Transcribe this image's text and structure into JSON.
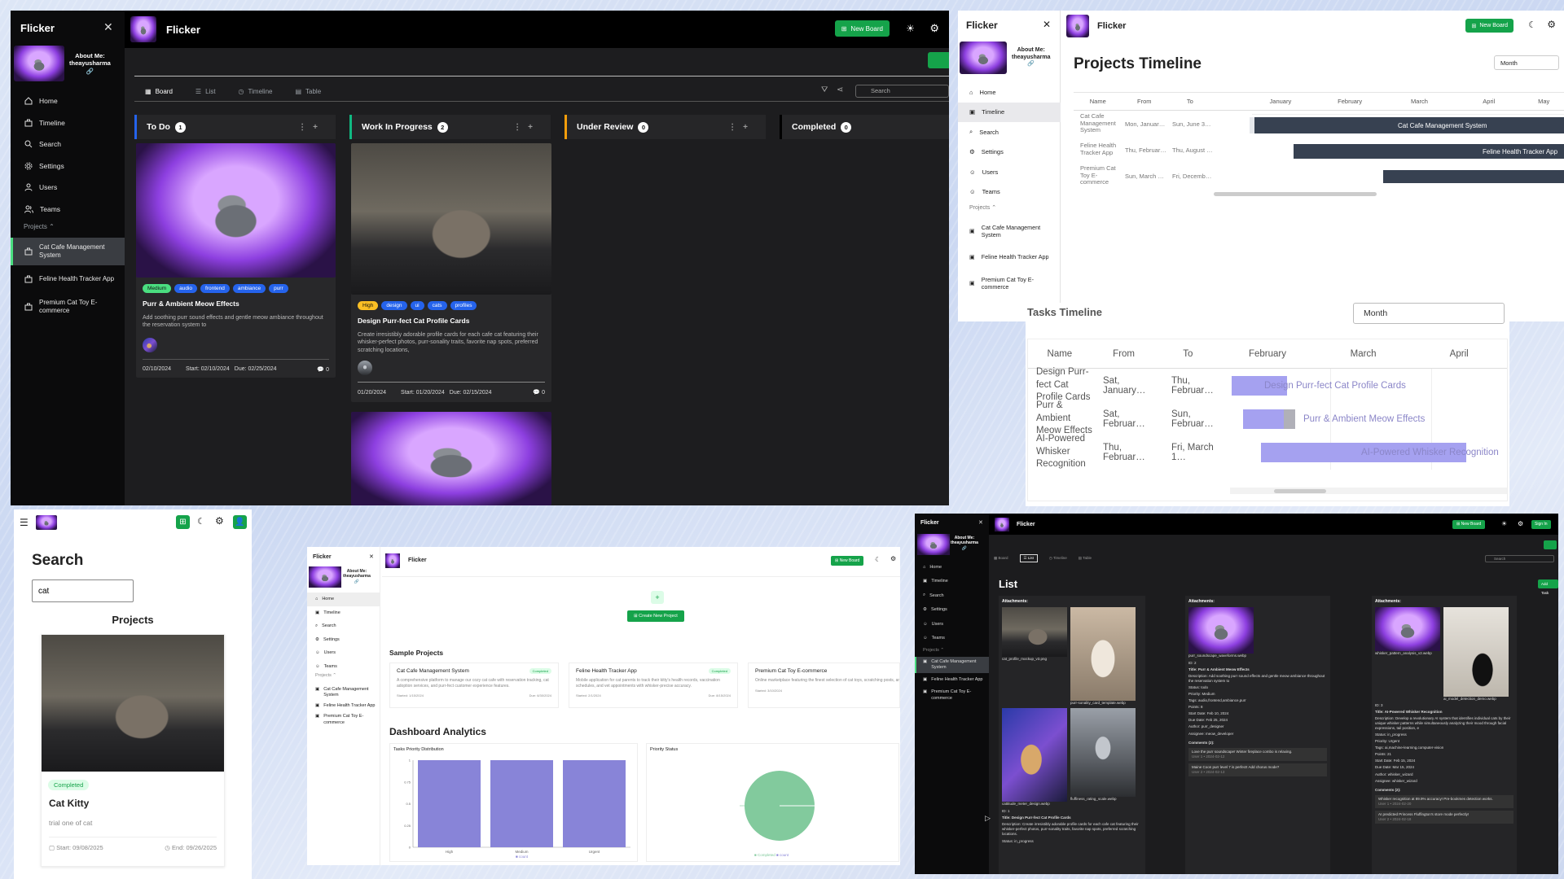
{
  "app": {
    "name": "Flicker",
    "about": "About Me:",
    "username": "theayusharma"
  },
  "nav": [
    "Home",
    "Timeline",
    "Search",
    "Settings",
    "Users",
    "Teams"
  ],
  "projects_header": "Projects",
  "projects": [
    "Cat Cafe Management System",
    "Feline Health Tracker App",
    "Premium Cat Toy E-commerce"
  ],
  "new_board": "New Board",
  "board": {
    "tabs": [
      "Board",
      "List",
      "Timeline",
      "Table"
    ],
    "search_placeholder": "Search",
    "columns": [
      {
        "name": "To Do",
        "count": "1",
        "color": "#2563eb"
      },
      {
        "name": "Work In Progress",
        "count": "2",
        "color": "#10b981"
      },
      {
        "name": "Under Review",
        "count": "0",
        "color": "#f59e0b"
      },
      {
        "name": "Completed",
        "count": "0",
        "color": "#000000"
      }
    ],
    "card1": {
      "tags": [
        "Medium",
        "audio",
        "frontend",
        "ambiance",
        "purr"
      ],
      "title": "Purr & Ambient Meow Effects",
      "desc": "Add soothing purr sound effects and gentle meow ambiance throughout the reservation system to",
      "date": "02/10/2024",
      "start": "Start: 02/10/2024",
      "due": "Due: 02/25/2024",
      "comments": "0"
    },
    "card2": {
      "tags": [
        "High",
        "design",
        "ui",
        "cats",
        "profiles"
      ],
      "title": "Design Purr-fect Cat Profile Cards",
      "desc": "Create irresistibly adorable profile cards for each cafe cat featuring their whisker-perfect photos, purr-sonality traits, favorite nap spots, preferred scratching locations,",
      "date": "01/20/2024",
      "start": "Start: 01/20/2024",
      "due": "Due: 02/15/2024",
      "comments": "0"
    }
  },
  "projects_timeline": {
    "title": "Projects Timeline",
    "select": "Month",
    "cols": [
      "Name",
      "From",
      "To"
    ],
    "months": [
      "January",
      "February",
      "March",
      "April",
      "May"
    ],
    "rows": [
      {
        "name": "Cat Cafe Management System",
        "from": "Mon, Januar…",
        "to": "Sun, June 3…",
        "bar": "Cat Cafe Management System"
      },
      {
        "name": "Feline Health Tracker App",
        "from": "Thu, Februar…",
        "to": "Thu, August …",
        "bar": "Feline Health Tracker App"
      },
      {
        "name": "Premium Cat Toy E-commerce",
        "from": "Sun, March …",
        "to": "Fri, Decemb…",
        "bar": ""
      }
    ]
  },
  "tasks_timeline": {
    "title": "Tasks Timeline",
    "select": "Month",
    "cols": [
      "Name",
      "From",
      "To"
    ],
    "months": [
      "February",
      "March",
      "April"
    ],
    "rows": [
      {
        "name": "Design Purr-fect Cat Profile Cards",
        "from": "Sat, January…",
        "to": "Thu, Februar…",
        "bar": "Design Purr-fect Cat Profile Cards"
      },
      {
        "name": "Purr & Ambient Meow Effects",
        "from": "Sat, Februar…",
        "to": "Sun, Februar…",
        "bar": "Purr & Ambient Meow Effects"
      },
      {
        "name": "AI-Powered Whisker Recognition",
        "from": "Thu, Februar…",
        "to": "Fri, March 1…",
        "bar": "AI-Powered Whisker Recognition"
      }
    ]
  },
  "search_page": {
    "title": "Search",
    "query": "cat",
    "section": "Projects",
    "badge": "Completed",
    "card_title": "Cat Kitty",
    "card_desc": "trial one of cat",
    "start": "Start: 09/08/2025",
    "end": "End: 09/26/2025"
  },
  "home": {
    "create": "Create New Project",
    "sample": "Sample Projects",
    "cards": [
      {
        "t": "Cat Cafe Management System",
        "b": "Completed",
        "d": "A comprehensive platform to manage our cozy cat cafe with reservation tracking, cat adoption services, and purr-fect customer experience features.",
        "s": "Started: 1/15/2024",
        "e": "Due: 6/30/2024"
      },
      {
        "t": "Feline Health Tracker App",
        "b": "Completed",
        "d": "Mobile application for cat parents to track their kitty's health records, vaccination schedules, and vet appointments with whisker-precise accuracy.",
        "s": "Started: 2/1/2024",
        "e": "Due: 8/15/2024"
      },
      {
        "t": "Premium Cat Toy E-commerce",
        "b": "",
        "d": "Online marketplace featuring the finest selection of cat toys, scratching posts, and interactive play equipment that will make every cat purr with joy.",
        "s": "Started: 3/10/2024",
        "e": ""
      }
    ],
    "analytics": "Dashboard Analytics",
    "bar_title": "Tasks Priority Distribution",
    "pie_title": "Priority Status",
    "bar_legend": "count",
    "pie_legend": [
      "Completed",
      "count"
    ]
  },
  "list_page": {
    "title": "List",
    "add": "Add Task",
    "sign": "Sign In",
    "att": "Attachments:",
    "col1": {
      "files": [
        "cat_profile_mockup_v3.png",
        "purr-sonality_card_template.webp",
        "cattitude_meter_design.webp",
        "fluffiness_rating_scale.webp"
      ],
      "id": "ID: 1",
      "title": "Title: Design Purr-fect Cat Profile Cards",
      "desc": "Description: Create irresistibly adorable profile cards for each cafe cat featuring their whisker-perfect photos, purr-sonality traits, favorite nap spots, preferred scratching locations.",
      "status": "Status: in_progress"
    },
    "col2": {
      "files": [
        "purr_soundscape_waveforms.webp"
      ],
      "id": "ID: 2",
      "title": "Title: Purr & Ambient Meow Effects",
      "desc": "Description: Add soothing purr sound effects and gentle meow ambiance throughout the reservation system to",
      "status": "Status: todo",
      "priority": "Priority: Medium",
      "tags": "Tags: audio,frontend,ambiance,purr",
      "points": "Points: 8",
      "start": "Start Date: Feb 10, 2024",
      "due": "Due Date: Feb 25, 2024",
      "author": "Author: purr_designer",
      "assignee": "Assignee: meow_developer",
      "comments": "Comments (2):",
      "c1": "Love the purr soundscape! Winter fireplace combo is relaxing.",
      "c1u": "User 1 • 2024-02-12",
      "c2": "Maine Coon purr level 7 is perfect! Add chorus mode?",
      "c2u": "User 2 • 2024-02-13"
    },
    "col3": {
      "files": [
        "whisker_pattern_analysis_v2.webp",
        "ai_model_detection_demo.webp"
      ],
      "id": "ID: 3",
      "title": "Title: AI-Powered Whisker Recognition",
      "desc": "Description: Develop a revolutionary AI system that identifies individual cats by their unique whisker patterns while simultaneously analyzing their mood through facial expressions, tail position, e",
      "status": "Status: in_progress",
      "priority": "Priority: Urgent",
      "tags": "Tags: ai,machine-learning,computer-vision",
      "points": "Points: 21",
      "start": "Start Date: Feb 15, 2024",
      "due": "Due Date: Mar 15, 2024",
      "author": "Author: whisker_wizard",
      "assignee": "Assignee: whisker_wizard",
      "comments": "Comments (2):",
      "c1": "Whisker recognition at 89.9% accuracy! Pre-bookmes detection works.",
      "c1u": "User 1 • 2024-02-20",
      "c2": "AI predicted Princess Fluffington's store mode perfectly!",
      "c2u": "User 2 • 2024-02-18"
    }
  },
  "chart_data": {
    "type": "bar",
    "title": "Tasks Priority Distribution",
    "categories": [
      "High",
      "Medium",
      "Urgent"
    ],
    "series": [
      {
        "name": "count",
        "values": [
          1,
          1,
          1
        ]
      }
    ],
    "ylim": [
      0,
      1
    ],
    "yticks": [
      "0",
      "0.25",
      "0.5",
      "0.75",
      "1"
    ]
  },
  "colors": {
    "accent": "#15a34a",
    "bar": "#8884d8",
    "pie": "#82ca9d",
    "gantt": "#a5a1f0",
    "ganttDark": "#374151"
  }
}
